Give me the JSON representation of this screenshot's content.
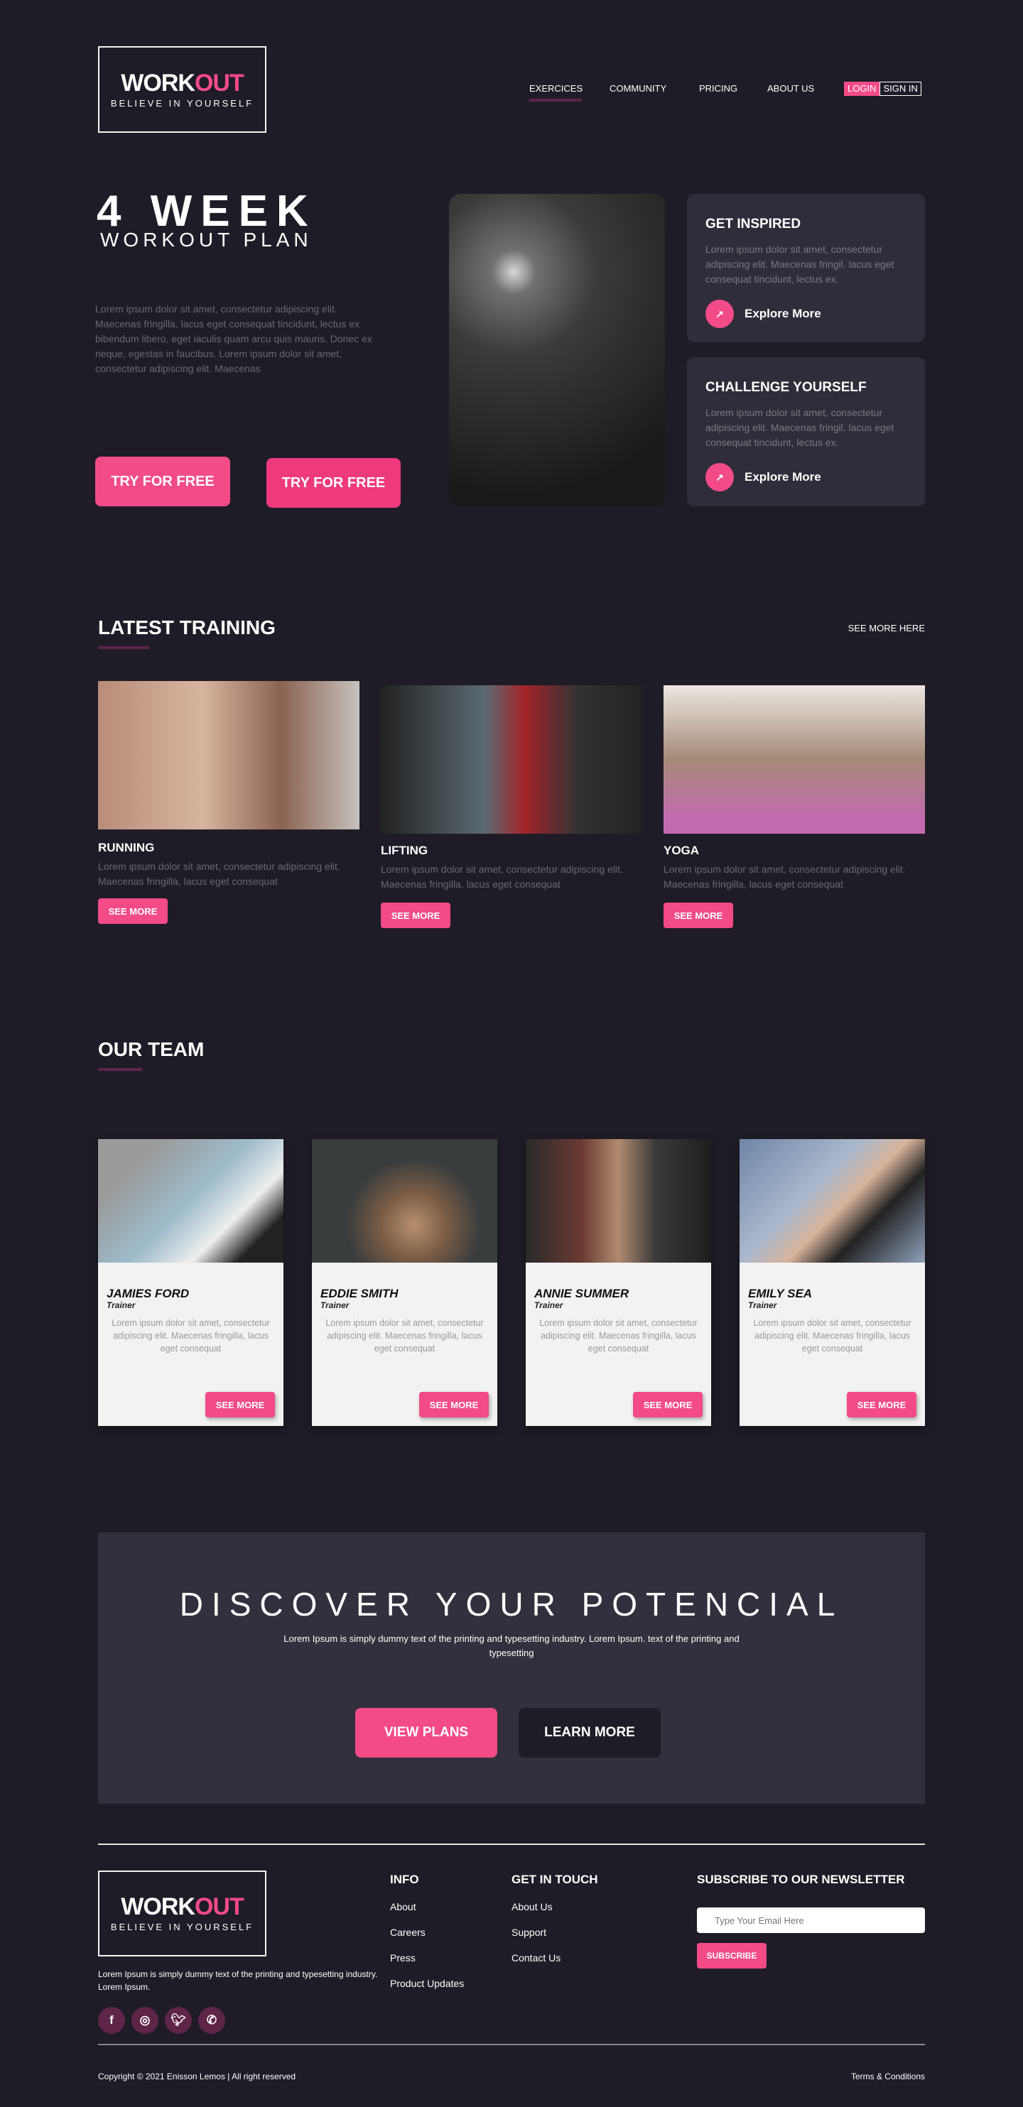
{
  "brand": {
    "word1": "WORK",
    "word2": "OUT",
    "tagline": "BELIEVE IN YOURSELF"
  },
  "nav": {
    "items": [
      "EXERCICES",
      "COMMUNITY",
      "PRICING",
      "ABOUT US"
    ],
    "active": "EXERCICES",
    "login": "LOGIN",
    "signin": "SIGN IN"
  },
  "hero": {
    "title": "4 WEEK",
    "subtitle": "WORKOUT PLAN",
    "text": "Lorem ipsum dolor sit amet, consectetur adipiscing elit. Maecenas fringilla, lacus eget consequat tincidunt, lectus ex bibendum libero, eget iaculis quam arcu quis mauris. Donec ex neque, egestas in faucibus. Lorem ipsum dolor sit amet, consectetur adipiscing elit. Maecenas",
    "cta1": "TRY FOR FREE",
    "cta2": "TRY FOR FREE"
  },
  "cards": [
    {
      "title": "GET INSPIRED",
      "text": "Lorem ipsum dolor sit amet, consectetur adipiscing elit. Maecenas fringil. lacus eget consequat tincidunt, lectus ex.",
      "link": "Explore More",
      "icon": "arrow-up-right-icon"
    },
    {
      "title": "CHALLENGE YOURSELF",
      "text": "Lorem ipsum dolor sit amet, consectetur adipiscing elit. Maecenas fringil. lacus eget consequat tincidunt, lectus ex.",
      "link": "Explore More",
      "icon": "arrow-up-right-icon"
    }
  ],
  "training": {
    "title": "LATEST TRAINING",
    "see_more": "SEE MORE HERE",
    "items": [
      {
        "title": "RUNNING",
        "text": "Lorem ipsum dolor sit amet, consectetur adipiscing elit. Maecenas fringilla, lacus eget consequat",
        "button": "SEE MORE"
      },
      {
        "title": "LIFTING",
        "text": "Lorem ipsum dolor sit amet, consectetur adipiscing elit. Maecenas fringilla, lacus eget consequat",
        "button": "SEE MORE"
      },
      {
        "title": "YOGA",
        "text": "Lorem ipsum dolor sit amet, consectetur adipiscing elit. Maecenas fringilla, lacus eget consequat",
        "button": "SEE MORE"
      }
    ]
  },
  "team": {
    "title": "OUR TEAM",
    "members": [
      {
        "name": "JAMIES FORD",
        "role": "Trainer",
        "text": "Lorem ipsum dolor sit amet, consectetur adipiscing elit. Maecenas fringilla, lacus eget consequat",
        "button": "SEE MORE"
      },
      {
        "name": "EDDIE SMITH",
        "role": "Trainer",
        "text": "Lorem ipsum dolor sit amet, consectetur adipiscing elit. Maecenas fringilla, lacus eget consequat",
        "button": "SEE MORE"
      },
      {
        "name": "ANNIE SUMMER",
        "role": "Trainer",
        "text": "Lorem ipsum dolor sit amet, consectetur adipiscing elit. Maecenas fringilla, lacus eget consequat",
        "button": "SEE MORE"
      },
      {
        "name": "EMILY SEA",
        "role": "Trainer",
        "text": "Lorem ipsum dolor sit amet, consectetur adipiscing elit. Maecenas fringilla, lacus eget consequat",
        "button": "SEE MORE"
      }
    ]
  },
  "discover": {
    "title": "DISCOVER YOUR POTENCIAL",
    "text": "Lorem Ipsum is simply dummy text of the printing and typesetting industry. Lorem Ipsum.  text of the printing and typesetting",
    "primary": "VIEW PLANS",
    "secondary": "LEARN MORE"
  },
  "footer": {
    "about": "Lorem Ipsum is simply dummy text of the printing and typesetting industry. Lorem Ipsum.",
    "info_title": "INFO",
    "info_links": [
      "About",
      "Careers",
      "Press",
      "Product Updates"
    ],
    "touch_title": "GET IN TOUCH",
    "touch_links": [
      "About Us",
      "Support",
      "Contact Us"
    ],
    "newsletter_title": "SUBSCRIBE TO OUR NEWSLETTER",
    "email_placeholder": "Type Your Email Here",
    "subscribe": "SUBSCRIBE",
    "social": [
      "facebook-icon",
      "instagram-icon",
      "twitter-icon",
      "whatsapp-icon"
    ],
    "copyright": "Copyright © 2021 Enisson Lemos | All right reserved",
    "terms": "Terms & Conditions"
  },
  "colors": {
    "bg": "#1f1c27",
    "accent": "#f24b88",
    "card": "#302d3a",
    "underline": "#5e2547"
  }
}
